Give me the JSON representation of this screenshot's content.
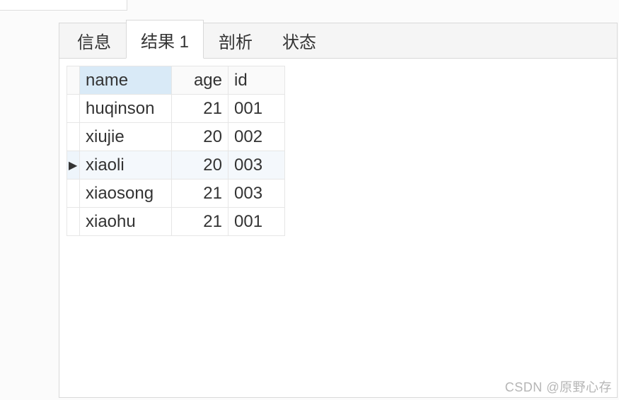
{
  "tabs": [
    {
      "label": "信息",
      "active": false
    },
    {
      "label": "结果 1",
      "active": true
    },
    {
      "label": "剖析",
      "active": false
    },
    {
      "label": "状态",
      "active": false
    }
  ],
  "columns": {
    "c0": "name",
    "c1": "age",
    "c2": "id"
  },
  "selectedRow": 2,
  "rows": [
    {
      "name": "huqinson",
      "age": "21",
      "id": "001"
    },
    {
      "name": "xiujie",
      "age": "20",
      "id": "002"
    },
    {
      "name": "xiaoli",
      "age": "20",
      "id": "003"
    },
    {
      "name": "xiaosong",
      "age": "21",
      "id": "003"
    },
    {
      "name": "xiaohu",
      "age": "21",
      "id": "001"
    }
  ],
  "rowmark": "▶",
  "watermark": "CSDN @原野心存",
  "chart_data": {
    "type": "table",
    "columns": [
      "name",
      "age",
      "id"
    ],
    "rows": [
      [
        "huqinson",
        21,
        "001"
      ],
      [
        "xiujie",
        20,
        "002"
      ],
      [
        "xiaoli",
        20,
        "003"
      ],
      [
        "xiaosong",
        21,
        "003"
      ],
      [
        "xiaohu",
        21,
        "001"
      ]
    ]
  }
}
